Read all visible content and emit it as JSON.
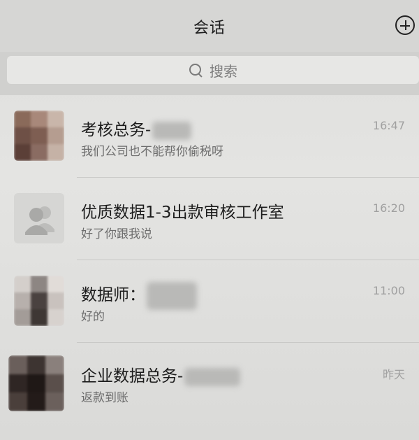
{
  "header": {
    "title": "会话",
    "add_icon": "plus-circle-icon"
  },
  "search": {
    "placeholder": "搜索",
    "icon": "search-icon"
  },
  "conversations": [
    {
      "name": "考核总务-",
      "message": "我们公司也不能帮你偷税呀",
      "time": "16:47",
      "avatar": "blurred-photo",
      "name_redacted": true
    },
    {
      "name": "优质数据1-3出款审核工作室",
      "message": "好了你跟我说",
      "time": "16:20",
      "avatar": "group-icon",
      "name_redacted": false
    },
    {
      "name": "数据师：",
      "message": "好的",
      "time": "11:00",
      "avatar": "blurred-photo",
      "name_redacted": true
    },
    {
      "name": "企业数据总务-",
      "message": "返款到账",
      "time": "昨天",
      "avatar": "blurred-photo",
      "name_redacted": true
    }
  ]
}
